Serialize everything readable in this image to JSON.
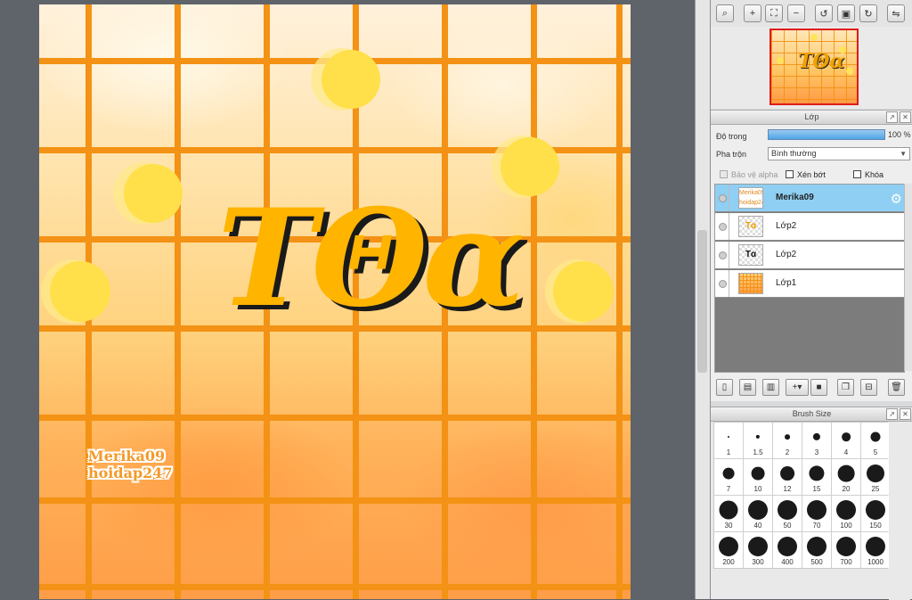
{
  "canvas": {
    "title_text": "ΤΘα",
    "watermark_lines": [
      "Merika09",
      "hoidap247"
    ],
    "colors": {
      "grid": "#f39214",
      "dot": "#ffe04a",
      "text_gold": "#ffb400",
      "text_shadow": "#1a1a1a"
    }
  },
  "navigator_toolbar": {
    "buttons": [
      {
        "icon": "zoom-fit-icon",
        "glyph": "⌕"
      },
      {
        "icon": "zoom-in-icon",
        "glyph": "+"
      },
      {
        "icon": "fit-window-icon",
        "glyph": "⛶"
      },
      {
        "icon": "zoom-out-icon",
        "glyph": "−"
      },
      {
        "icon": "rotate-left-icon",
        "glyph": "↺"
      },
      {
        "icon": "actual-size-icon",
        "glyph": "▣"
      },
      {
        "icon": "rotate-right-icon",
        "glyph": "↻"
      },
      {
        "icon": "flip-icon",
        "glyph": "⇋"
      }
    ]
  },
  "layer_panel": {
    "title": "Lớp",
    "opacity_label": "Độ trong",
    "opacity_value": "100 %",
    "opacity_fraction": 1.0,
    "blend_label": "Pha trộn",
    "blend_value": "Bình thường",
    "protect_alpha_label": "Bảo vệ alpha",
    "clip_label": "Xén bớt",
    "lock_label": "Khóa",
    "layers": [
      {
        "name": "Merika09",
        "thumb_text": "Merika09 hoidap247",
        "selected": true
      },
      {
        "name": "Lớp2",
        "thumb_text": "Tα",
        "selected": false
      },
      {
        "name": "Lớp2",
        "thumb_text": "Tα",
        "selected": false
      },
      {
        "name": "Lớp1",
        "thumb_text": "",
        "selected": false
      }
    ],
    "toolbar_icons": [
      "new-layer-icon",
      "new-raster-icon",
      "new-1bit-icon",
      "new-layer-menu-icon",
      "new-folder-icon",
      "copy-layer-icon",
      "merge-layer-icon",
      "delete-layer-icon"
    ]
  },
  "brush_panel": {
    "title": "Brush Size",
    "sizes": [
      "1",
      "1.5",
      "2",
      "3",
      "4",
      "5",
      "7",
      "10",
      "12",
      "15",
      "20",
      "25",
      "30",
      "40",
      "50",
      "70",
      "100",
      "150",
      "200",
      "300",
      "400",
      "500",
      "700",
      "1000"
    ]
  }
}
